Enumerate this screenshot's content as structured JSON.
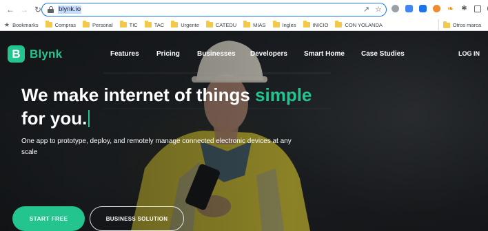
{
  "browser": {
    "url": "blynk.io",
    "bookmarks": [
      {
        "label": "Bookmarks",
        "type": "star"
      },
      {
        "label": "Compras",
        "type": "folder"
      },
      {
        "label": "Personal",
        "type": "folder"
      },
      {
        "label": "TIC",
        "type": "folder"
      },
      {
        "label": "TAC",
        "type": "folder"
      },
      {
        "label": "Urgente",
        "type": "folder"
      },
      {
        "label": "CATEDU",
        "type": "folder"
      },
      {
        "label": "MIAS",
        "type": "folder"
      },
      {
        "label": "Ingles",
        "type": "folder"
      },
      {
        "label": "INICIO",
        "type": "folder"
      },
      {
        "label": "CON YOLANDA",
        "type": "folder"
      }
    ],
    "other_bookmarks": "Otros marca",
    "colors": {
      "omnibox_focus": "#1a73e8",
      "folder": "#f2c94c"
    }
  },
  "site": {
    "logo_letter": "B",
    "logo_text": "Blynk",
    "nav": [
      "Features",
      "Pricing",
      "Businesses",
      "Developers",
      "Smart Home",
      "Case Studies"
    ],
    "login": "LOG IN",
    "headline_line1": "We make internet of things ",
    "headline_accent": "simple",
    "headline_line2": "for you.",
    "subtext": "One app to prototype, deploy, and remotely manage connected electronic devices at any scale",
    "cta_primary": "START FREE",
    "cta_secondary": "BUSINESS SOLUTION",
    "colors": {
      "brand": "#23c48e",
      "hero_bg": "#1d2024"
    }
  }
}
